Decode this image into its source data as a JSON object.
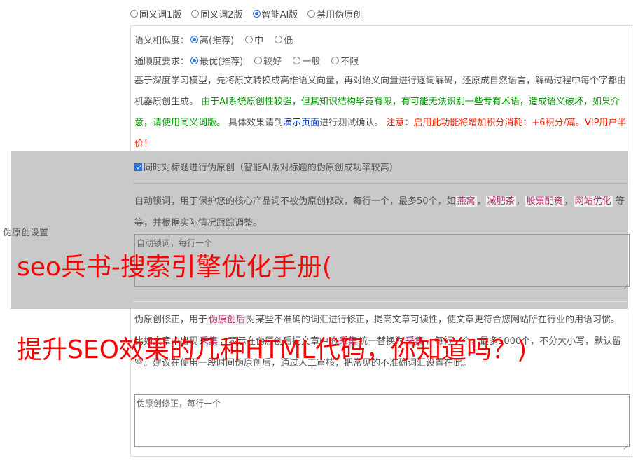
{
  "version_options": [
    {
      "label": "同义词1版",
      "checked": false
    },
    {
      "label": "同义词2版",
      "checked": false
    },
    {
      "label": "智能AI版",
      "checked": true
    },
    {
      "label": "禁用伪原创",
      "checked": false
    }
  ],
  "similarity": {
    "label": "语义相似度：",
    "options": [
      {
        "label": "高(推荐)",
        "checked": true
      },
      {
        "label": "中",
        "checked": false
      },
      {
        "label": "低",
        "checked": false
      }
    ]
  },
  "fluency": {
    "label": "通顺度要求：",
    "options": [
      {
        "label": "最优(推荐)",
        "checked": true
      },
      {
        "label": "较好",
        "checked": false
      },
      {
        "label": "一般",
        "checked": false
      },
      {
        "label": "不限",
        "checked": false
      }
    ]
  },
  "description": {
    "part1": "基于深度学习模型，先将原文转换成高维语义向量，再对语义向量进行逐词解码，还原成自然语言，解码过程中每个字都由机器原创生成。",
    "part2_green": "由于AI系统原创性较强，但其知识结构毕竟有限，有可能无法识别一些专有术语，造成语义破坏，如果介意，请使用同义词版。",
    "part3": "具体效果请到",
    "link": "演示页面",
    "part4": "进行测试确认。",
    "part5_red": "注意：启用此功能将增加积分消耗：+6积分/篇。VIP用户半价！"
  },
  "title_checkbox": {
    "label": "同时对标题进行伪原创（智能AI版对标题的伪原创成功率较高）",
    "checked": true
  },
  "side_label": "伪原创设置",
  "lock_words": {
    "intro": "自动锁词，用于保护您的核心产品词不被伪原创修改，每行一个，最多50个，如",
    "tags": [
      "燕窝",
      "减肥茶",
      "股票配资",
      "网站优化"
    ],
    "sep": "，",
    "outro": "等等，并根据实际情况跟踪调整。",
    "placeholder": "自动锁词，每行一个"
  },
  "correction": {
    "intro": "伪原创修正，用于",
    "tag1": "伪原创后",
    "text1": "对某些不准确的词汇进行修正，提高文章可读性，使文章更符合您网站所在行业的用语习惯。比如文章中出现",
    "tag2": "采集",
    "text2": "，表示在伪原创后把文章中的",
    "tag3": "采集",
    "text3": "统一替换为",
    "tag4": "采集",
    "text4": "，每行一个，最多1000个，不分大小写，默认留空。建议在使用一段时间伪原创后，通过人工审核，把常见的不准确词汇设置在此。",
    "placeholder": "伪原创修正，每行一个"
  },
  "overlay": {
    "line1": "seo兵书-搜索引擎优化手册(",
    "line2": "提升SEO效果的几种HTML代码，你知道吗？)"
  }
}
